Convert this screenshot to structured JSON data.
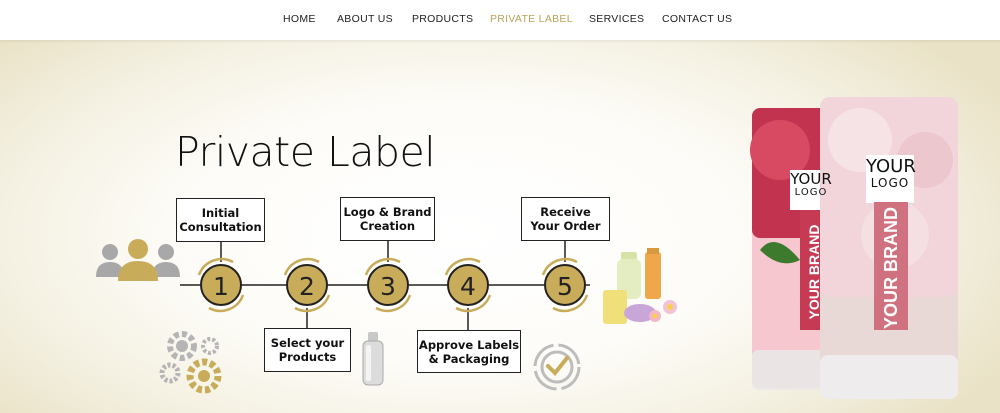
{
  "nav": {
    "items": [
      {
        "label": "HOME",
        "active": false
      },
      {
        "label": "ABOUT US",
        "active": false
      },
      {
        "label": "PRODUCTS",
        "active": false
      },
      {
        "label": "PRIVATE LABEL",
        "active": true
      },
      {
        "label": "SERVICES",
        "active": false
      },
      {
        "label": "CONTACT US",
        "active": false
      }
    ],
    "active_color": "#b9a35a"
  },
  "hero": {
    "title": "Private Label",
    "steps": [
      {
        "number": "1",
        "label": "Initial\nConsultation"
      },
      {
        "number": "2",
        "label": "Select your\nProducts"
      },
      {
        "number": "3",
        "label": "Logo & Brand\nCreation"
      },
      {
        "number": "4",
        "label": "Approve Labels\n& Packaging"
      },
      {
        "number": "5",
        "label": "Receive\nYour Order"
      }
    ],
    "accent_color": "#c9ac5a",
    "tubes": [
      {
        "logo_line1": "YOUR",
        "logo_line2": "LOGO",
        "brand": "YOUR BRAND"
      },
      {
        "logo_line1": "YOUR",
        "logo_line2": "LOGO",
        "brand": "YOUR BRAND"
      }
    ]
  }
}
